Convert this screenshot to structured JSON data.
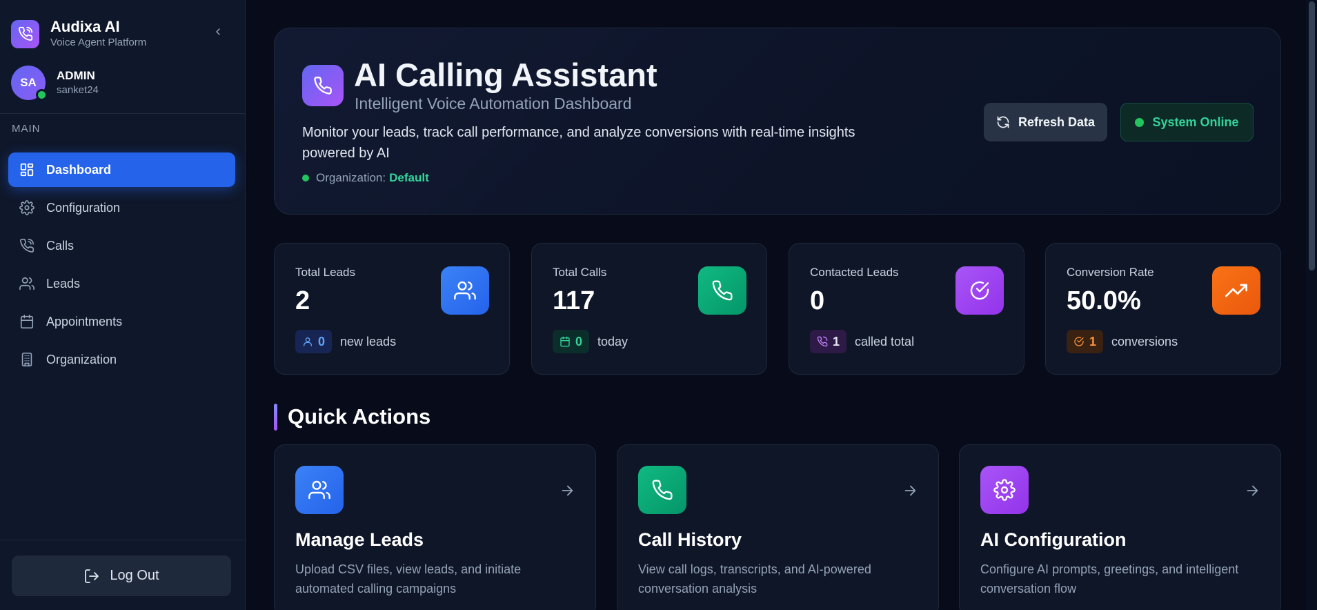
{
  "sidebar": {
    "brand_name": "Audixa AI",
    "brand_subtitle": "Voice Agent Platform",
    "user": {
      "initials": "SA",
      "role": "ADMIN",
      "username": "sanket24"
    },
    "section_label": "MAIN",
    "items": [
      {
        "label": "Dashboard",
        "icon": "grid-icon",
        "active": true
      },
      {
        "label": "Configuration",
        "icon": "gear-icon"
      },
      {
        "label": "Calls",
        "icon": "phone-call-icon"
      },
      {
        "label": "Leads",
        "icon": "users-icon"
      },
      {
        "label": "Appointments",
        "icon": "calendar-icon"
      },
      {
        "label": "Organization",
        "icon": "building-icon"
      }
    ],
    "logout_label": "Log Out"
  },
  "hero": {
    "title": "AI Calling Assistant",
    "subtitle": "Intelligent Voice Automation Dashboard",
    "description": "Monitor your leads, track call performance, and analyze conversions with real-time insights powered by AI",
    "org_label": "Organization:",
    "org_value": "Default",
    "refresh_label": "Refresh Data",
    "status_label": "System Online"
  },
  "stats": [
    {
      "label": "Total Leads",
      "value": "2",
      "badge": "0",
      "foot": "new leads",
      "color": "#3b82f6"
    },
    {
      "label": "Total Calls",
      "value": "117",
      "badge": "0",
      "foot": "today",
      "color": "#10b981"
    },
    {
      "label": "Contacted Leads",
      "value": "0",
      "badge": "1",
      "foot": "called total",
      "color": "#a855f7"
    },
    {
      "label": "Conversion Rate",
      "value": "50.0%",
      "badge": "1",
      "foot": "conversions",
      "color": "#f97316"
    }
  ],
  "quick_actions": {
    "title": "Quick Actions",
    "cards": [
      {
        "title": "Manage Leads",
        "description": "Upload CSV files, view leads, and initiate automated calling campaigns"
      },
      {
        "title": "Call History",
        "description": "View call logs, transcripts, and AI-powered conversation analysis"
      },
      {
        "title": "AI Configuration",
        "description": "Configure AI prompts, greetings, and intelligent conversation flow"
      }
    ]
  },
  "colors": {
    "accent": "#2563eb",
    "online": "#22c55e",
    "org_value": "#34d399"
  }
}
